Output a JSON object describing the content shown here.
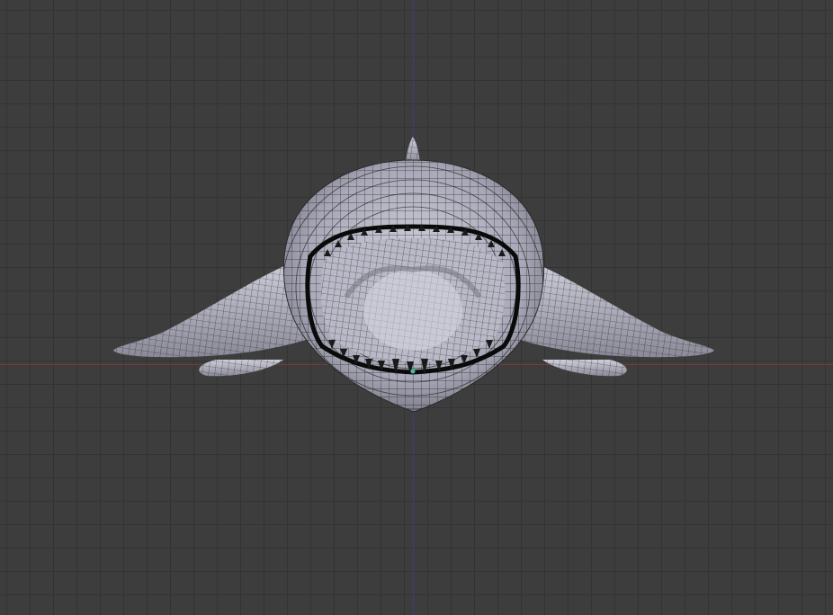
{
  "viewport": {
    "background": "#3d3d3d",
    "grid_line_color": "#333333",
    "x_axis_color": "#7a3a3a",
    "y_axis_color": "#3a3a8a",
    "view": "front-orthographic",
    "display_mode": "wireframe-over-solid"
  },
  "object": {
    "name": "",
    "mesh_color": "#c6c6d2",
    "wire_color": "#1a1a1a",
    "mouth_color": "#0a0a0a",
    "icon": "shark-mesh-icon"
  }
}
